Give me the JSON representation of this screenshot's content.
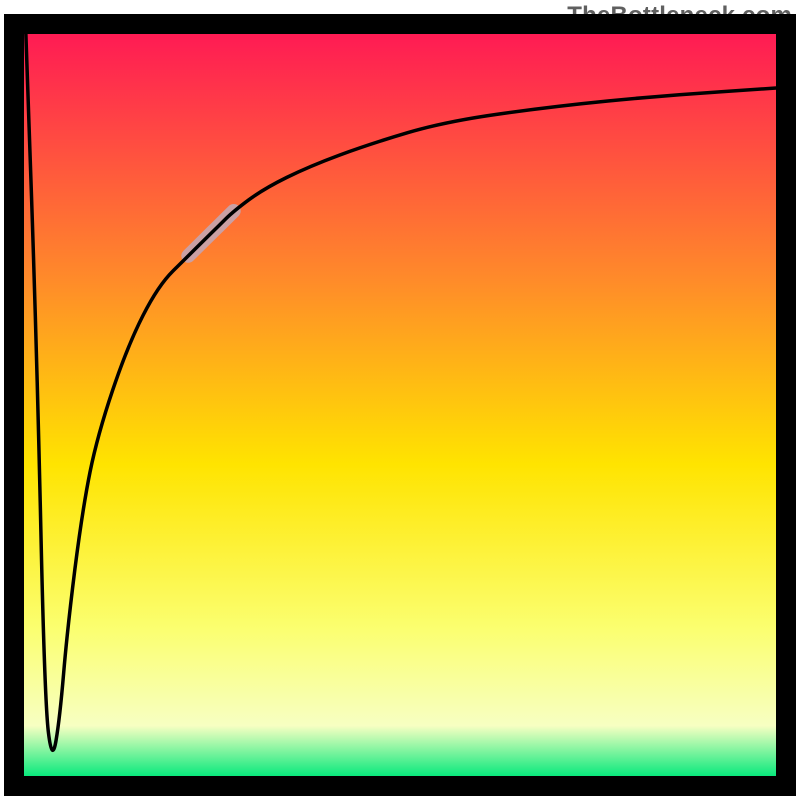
{
  "attribution": "TheBottleneck.com",
  "gradient": {
    "top": "#ff1a54",
    "q1": "#ff8a2a",
    "mid": "#ffe400",
    "q3": "#fbff70",
    "band": "#f7ffc2",
    "bottom": "#00e87a"
  },
  "frame": {
    "stroke": "#000000",
    "strokeWidth": 20
  },
  "highlight": {
    "color": "#caa0a4",
    "width": 14
  },
  "curve": {
    "stroke": "#000000",
    "width": 3.5
  },
  "chart_data": {
    "type": "line",
    "title": "",
    "xlabel": "",
    "ylabel": "",
    "xlim": [
      0,
      100
    ],
    "ylim": [
      0,
      100
    ],
    "grid": false,
    "series": [
      {
        "name": "bottleneck-curve",
        "x": [
          0.5,
          2,
          3,
          4,
          5,
          6,
          8,
          10,
          14,
          18,
          22,
          24,
          26,
          28,
          32,
          38,
          46,
          56,
          70,
          85,
          100
        ],
        "values": [
          100,
          56,
          10,
          2,
          8,
          20,
          36,
          46,
          58,
          66,
          70,
          72,
          74,
          76,
          79,
          82,
          85,
          88,
          90,
          91.5,
          92.5
        ]
      }
    ],
    "annotations": [
      {
        "name": "highlight-segment",
        "x_range": [
          22,
          28
        ],
        "note": "thick pale-pink overlay on curve"
      }
    ]
  }
}
